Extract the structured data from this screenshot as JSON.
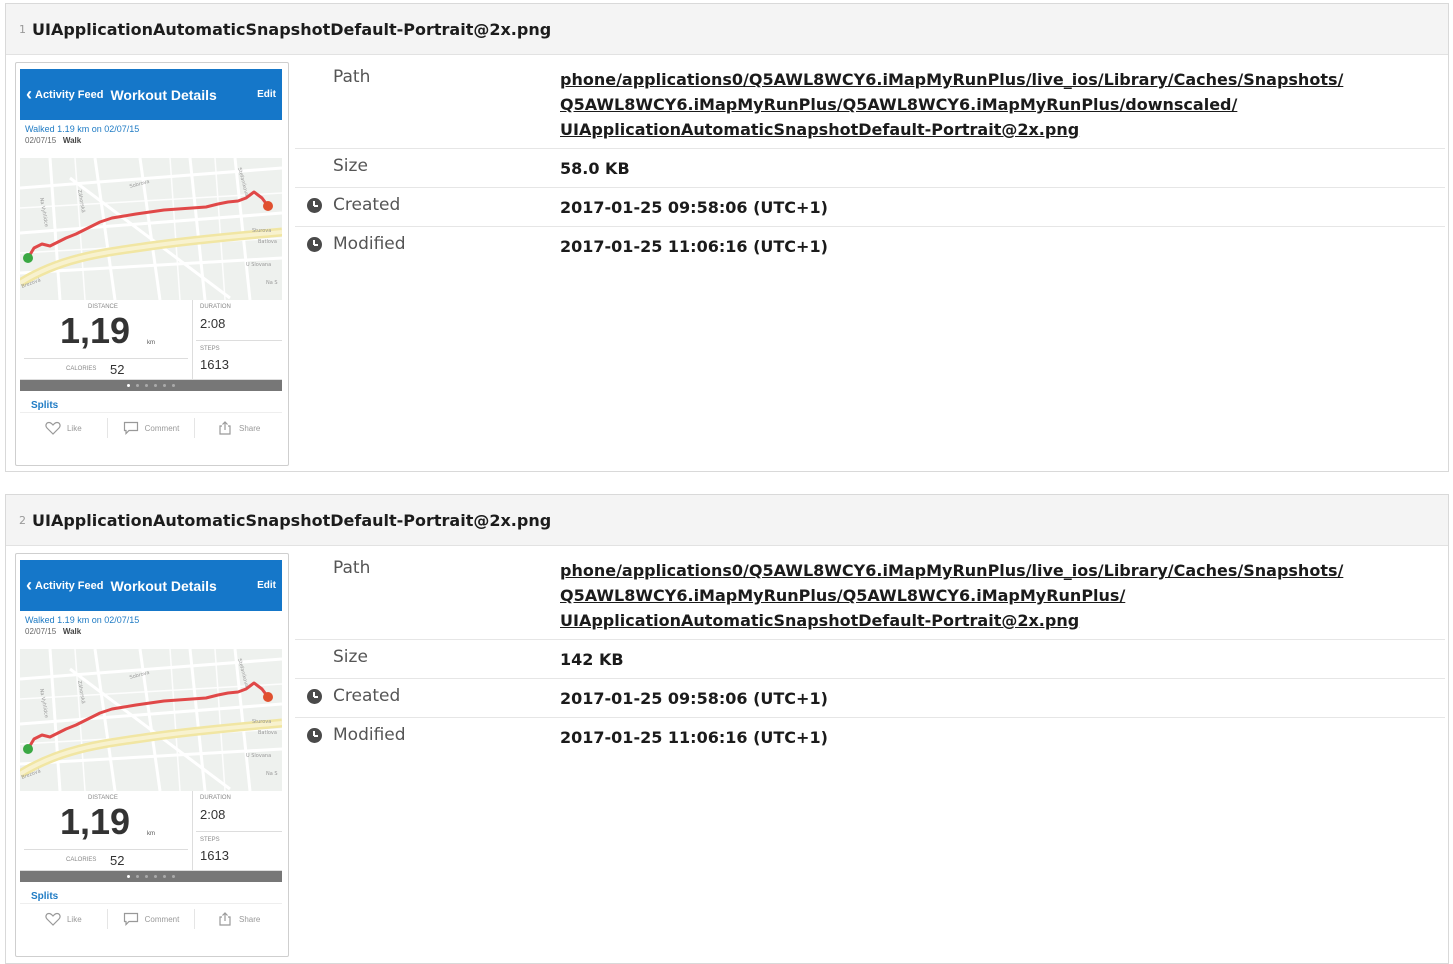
{
  "records": [
    {
      "index": "1",
      "title": "UIApplicationAutomaticSnapshotDefault-Portrait@2x.png",
      "path_label": "Path",
      "path_lines": [
        "phone/applications0/Q5AWL8WCY6.iMapMyRunPlus/live_ios/Library/Caches/Snapshots/",
        "Q5AWL8WCY6.iMapMyRunPlus/Q5AWL8WCY6.iMapMyRunPlus/downscaled/",
        "UIApplicationAutomaticSnapshotDefault-Portrait@2x.png"
      ],
      "size_label": "Size",
      "size": "58.0 KB",
      "created_label": "Created",
      "created": "2017-01-25 09:58:06 (UTC+1)",
      "modified_label": "Modified",
      "modified": "2017-01-25 11:06:16 (UTC+1)"
    },
    {
      "index": "2",
      "title": "UIApplicationAutomaticSnapshotDefault-Portrait@2x.png",
      "path_label": "Path",
      "path_lines": [
        "phone/applications0/Q5AWL8WCY6.iMapMyRunPlus/live_ios/Library/Caches/Snapshots/",
        "Q5AWL8WCY6.iMapMyRunPlus/Q5AWL8WCY6.iMapMyRunPlus/",
        "UIApplicationAutomaticSnapshotDefault-Portrait@2x.png"
      ],
      "size_label": "Size",
      "size": "142 KB",
      "created_label": "Created",
      "created": "2017-01-25 09:58:06 (UTC+1)",
      "modified_label": "Modified",
      "modified": "2017-01-25 11:06:16 (UTC+1)"
    }
  ],
  "snapshot": {
    "back_label": "Activity Feed",
    "title": "Workout Details",
    "edit_label": "Edit",
    "summary": "Walked 1.19 km on 02/07/15",
    "date": "02/07/15",
    "activity": "Walk",
    "map_labels": [
      "Sobrova",
      "Na Vyhlídce",
      "Záhorská",
      "Stefanikova",
      "Sturova",
      "Batlova",
      "U Slovana",
      "Na S",
      "Brezová"
    ],
    "distance_label": "DISTANCE",
    "distance_value": "1,19",
    "distance_unit": "km",
    "calories_label": "CALORIES",
    "calories_value": "52",
    "duration_label": "DURATION",
    "duration_value": "2:08",
    "steps_label": "STEPS",
    "steps_value": "1613",
    "splits_label": "Splits",
    "like_label": "Like",
    "comment_label": "Comment",
    "share_label": "Share",
    "accent_color": "#1577c9",
    "route_color": "#e04848",
    "start_color": "#3aa843",
    "end_color": "#e0502f"
  }
}
